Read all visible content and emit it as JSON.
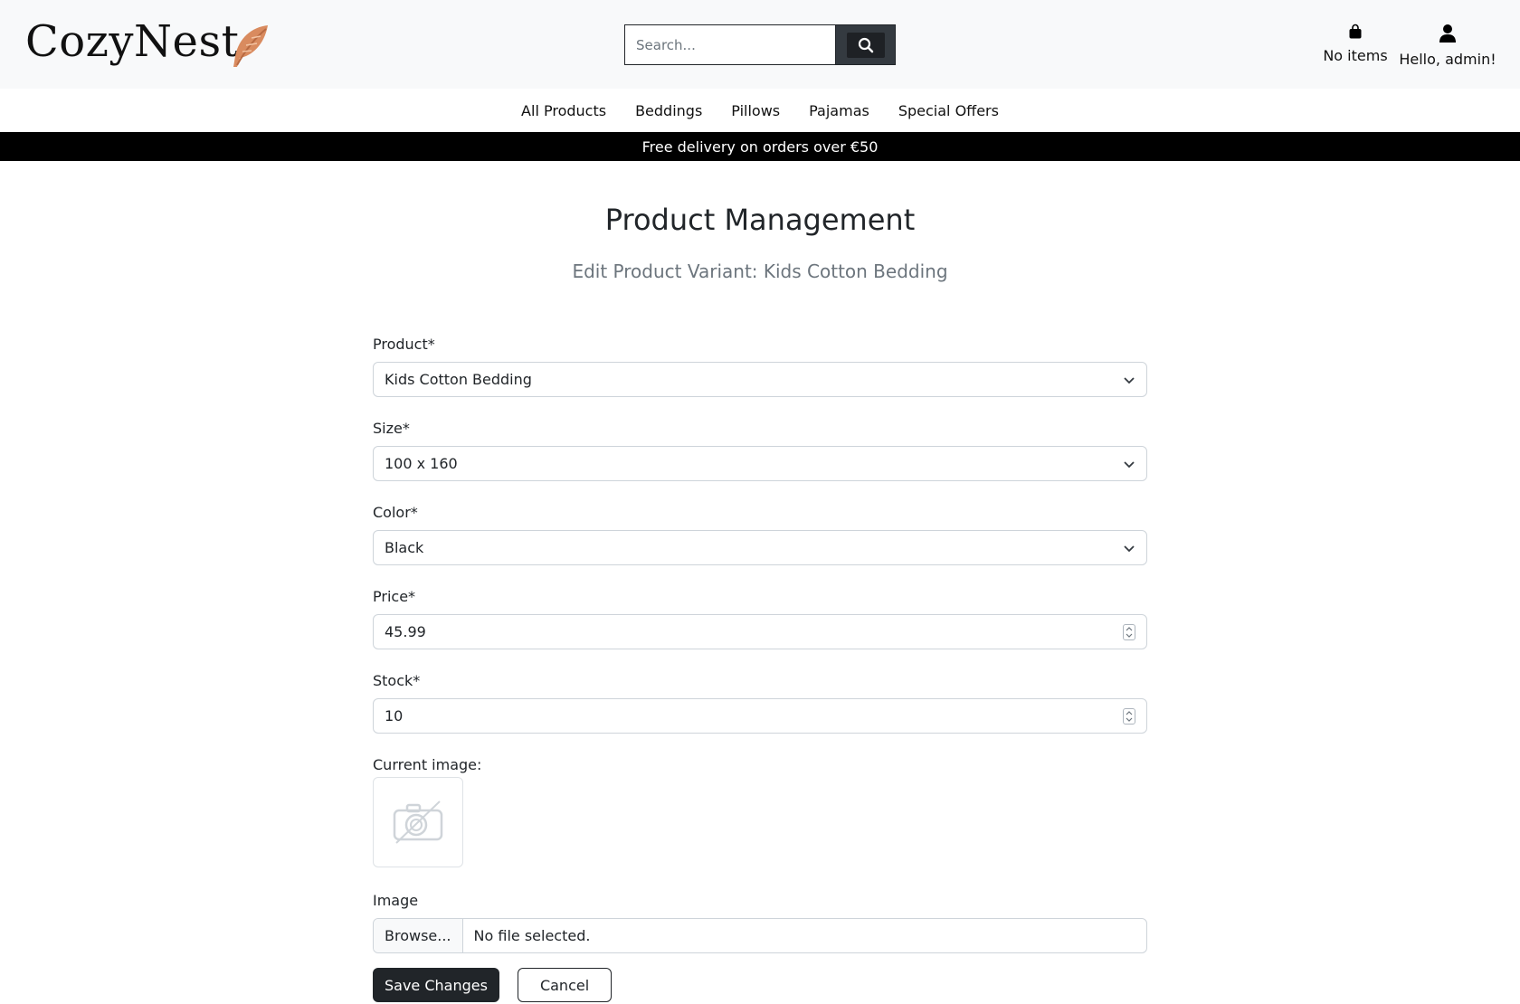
{
  "header": {
    "logo": "CozyNest",
    "search_placeholder": "Search...",
    "bag_label": "No items",
    "user_label": "Hello, admin!"
  },
  "nav": {
    "items": [
      "All Products",
      "Beddings",
      "Pillows",
      "Pajamas",
      "Special Offers"
    ]
  },
  "banner": "Free delivery on orders over €50",
  "page": {
    "title": "Product Management",
    "subtitle": "Edit Product Variant: Kids Cotton Bedding"
  },
  "form": {
    "product_label": "Product*",
    "product_value": "Kids Cotton Bedding",
    "size_label": "Size*",
    "size_value": "100 x 160",
    "color_label": "Color*",
    "color_value": "Black",
    "price_label": "Price*",
    "price_value": "45.99",
    "stock_label": "Stock*",
    "stock_value": "10",
    "current_image_label": "Current image:",
    "image_label": "Image",
    "browse_label": "Browse...",
    "no_file_label": "No file selected.",
    "save_label": "Save Changes",
    "cancel_label": "Cancel"
  },
  "colors": {
    "dark": "#212529",
    "banner": "#000000",
    "feather": "#d98b5f"
  },
  "icons": [
    "feather-icon",
    "search-icon",
    "shopping-bag-icon",
    "user-icon",
    "chevron-down-icon",
    "spinner-icon",
    "no-image-camera-icon"
  ]
}
